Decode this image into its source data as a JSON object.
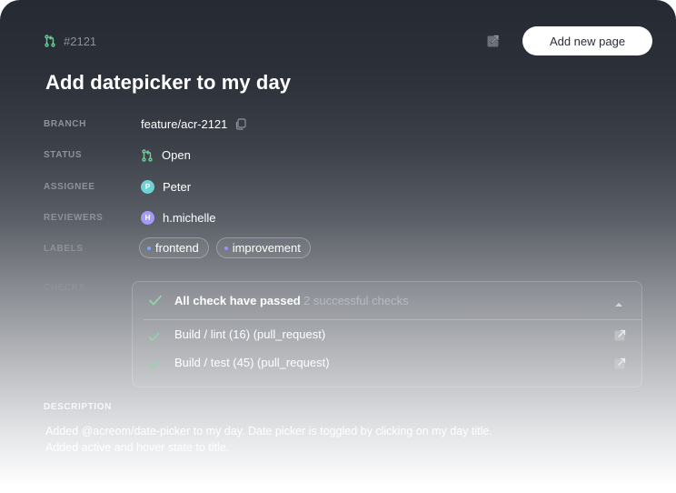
{
  "header": {
    "pr_number": "#2121",
    "add_button_label": "Add new page"
  },
  "title": "Add datepicker to my day",
  "fields": {
    "branch": {
      "label": "BRANCH",
      "value": "feature/acr-2121"
    },
    "status": {
      "label": "STATUS",
      "value": "Open"
    },
    "assignee": {
      "label": "ASSIGNEE",
      "value": "Peter",
      "initial": "P"
    },
    "reviewers": {
      "label": "REVIEWERS",
      "value": "h.michelle",
      "initial": "H"
    },
    "labels": {
      "label": "LABELS",
      "items": [
        {
          "text": "frontend",
          "color": "#7aa7ff"
        },
        {
          "text": "improvement",
          "color": "#a78bfa"
        }
      ]
    }
  },
  "checks": {
    "label": "CHECKS",
    "summary": "All check have passed",
    "summary_count": "2 successful checks",
    "items": [
      {
        "name": "Build / lint (16) (pull_request)"
      },
      {
        "name": "Build / test (45) (pull_request)"
      }
    ]
  },
  "description": {
    "label": "DESCRIPTION",
    "lines": [
      "Added @acreom/date-picker to my day. Date picker is toggled by clicking on my day title.",
      "Added active and hover state to title."
    ]
  },
  "colors": {
    "accent_green": "#6fcf97",
    "assignee_avatar": "#6fd3d6",
    "reviewer_avatar": "#a29bfe",
    "check_green": "#8fd6a8"
  }
}
